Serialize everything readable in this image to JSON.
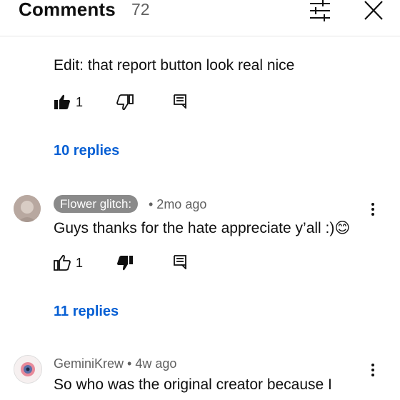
{
  "header": {
    "title": "Comments",
    "count": "72"
  },
  "comments": [
    {
      "text": "Edit: that report button look real nice",
      "likes": "1",
      "replies": "10 replies"
    },
    {
      "author": "Flower glitch:",
      "time": "• 2mo ago",
      "text": "Guys thanks for the hate appreciate y’all :)",
      "emoji": "😊",
      "likes": "1",
      "replies": "11 replies"
    },
    {
      "author": "GeminiKrew",
      "time": "• 4w ago",
      "text": "So who was the original creator because I"
    }
  ]
}
